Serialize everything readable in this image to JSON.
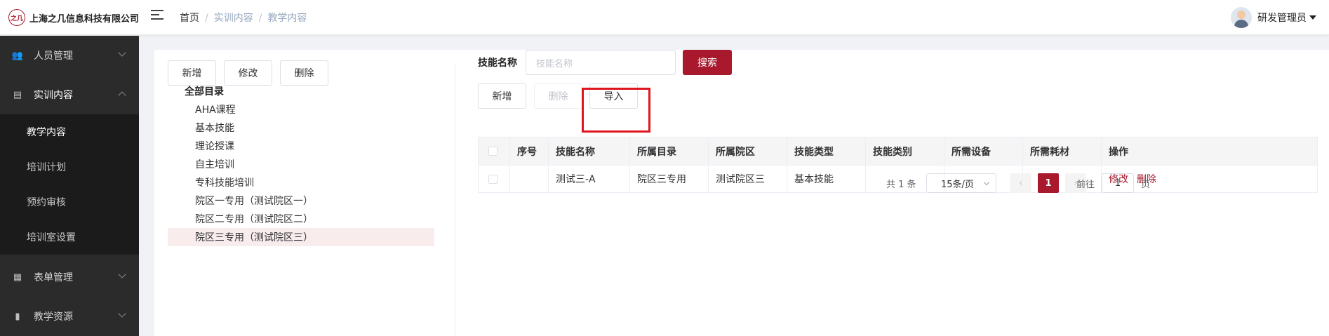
{
  "header": {
    "company": "上海之几信息科技有限公司",
    "logo_mark": "之几",
    "breadcrumb": [
      "首页",
      "实训内容",
      "教学内容"
    ],
    "user_name": "研发管理员"
  },
  "sidebar": {
    "groups": [
      {
        "label": "人员管理",
        "icon": "users-icon",
        "expanded": false
      },
      {
        "label": "实训内容",
        "icon": "book-icon",
        "expanded": true
      },
      {
        "label": "表单管理",
        "icon": "form-icon",
        "expanded": false
      },
      {
        "label": "教学资源",
        "icon": "resource-icon",
        "expanded": false
      }
    ],
    "sub_items": [
      {
        "label": "教学内容",
        "active": true
      },
      {
        "label": "培训计划",
        "active": false
      },
      {
        "label": "预约审核",
        "active": false
      },
      {
        "label": "培训室设置",
        "active": false
      }
    ]
  },
  "left_toolbar": {
    "add": "新增",
    "edit": "修改",
    "delete": "删除"
  },
  "tree": {
    "root": "全部目录",
    "nodes": [
      "AHA课程",
      "基本技能",
      "理论授课",
      "自主培训",
      "专科技能培训",
      "院区一专用（测试院区一）",
      "院区二专用（测试院区二）",
      "院区三专用（测试院区三）"
    ],
    "selected_index": 7
  },
  "search": {
    "label": "技能名称",
    "placeholder": "技能名称",
    "button": "搜索"
  },
  "right_toolbar": {
    "add": "新增",
    "delete": "删除",
    "import": "导入"
  },
  "table": {
    "columns": [
      "序号",
      "技能名称",
      "所属目录",
      "所属院区",
      "技能类型",
      "技能类别",
      "所需设备",
      "所需耗材",
      "操作"
    ],
    "rows": [
      {
        "index": "",
        "name": "测试三-A",
        "catalog": "院区三专用",
        "campus": "测试院区三",
        "type": "基本技能",
        "category": "",
        "equipment": "",
        "materials": "",
        "actions": [
          "修改",
          "删除"
        ]
      }
    ]
  },
  "pagination": {
    "total_text": "共 1 条",
    "page_size": "15条/页",
    "current_page": "1",
    "goto_label": "前往",
    "goto_value": "1",
    "page_suffix": "页",
    "prev": "‹",
    "next": "›"
  },
  "colors": {
    "accent": "#a8192e",
    "highlight_box": "#e0161e",
    "sidebar_bg": "#2b2b2b"
  }
}
